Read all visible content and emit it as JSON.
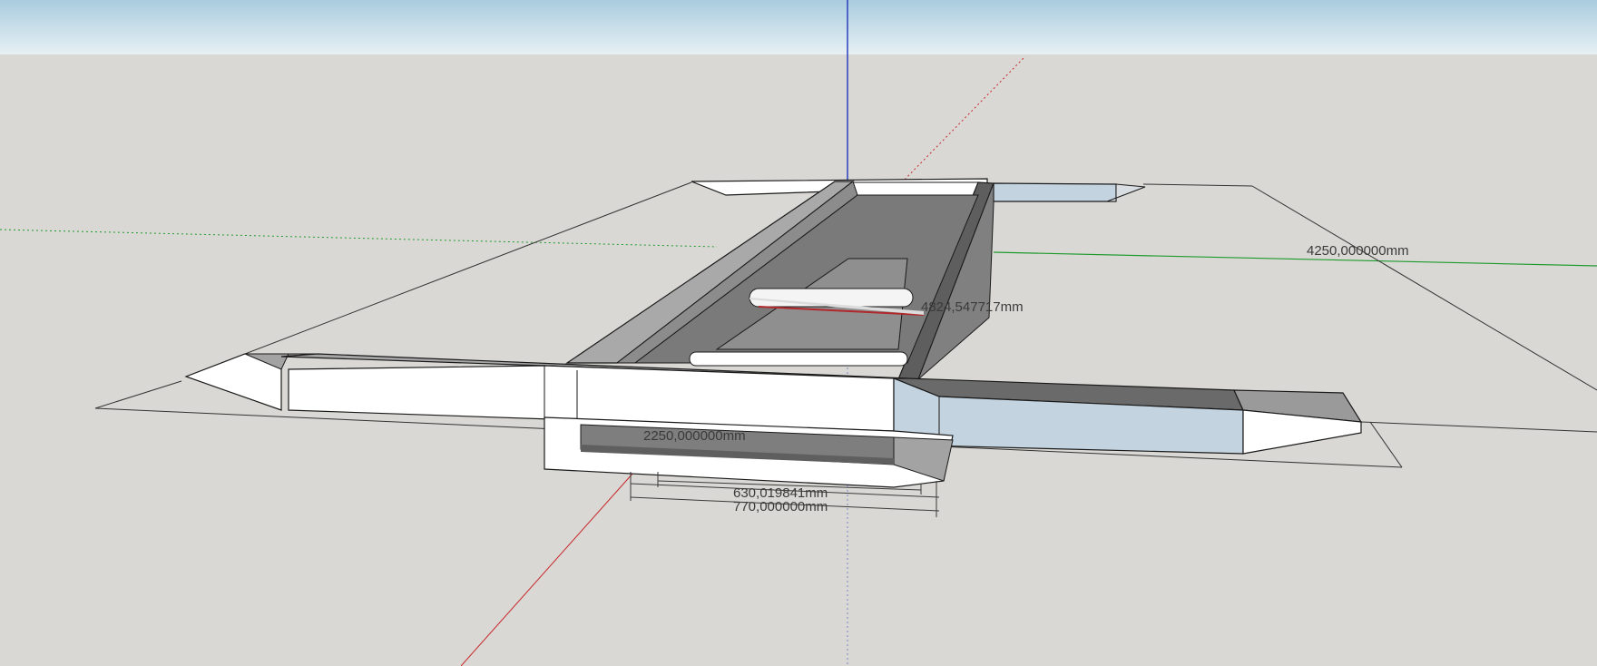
{
  "viewport": {
    "sky_top": "#a9ccde",
    "sky_bottom": "#e7f0f4",
    "ground": "#d9d8d4"
  },
  "axes": {
    "red": "#c8262a",
    "green": "#1e9a2c",
    "blue": "#2a3fbf"
  },
  "dimensions": {
    "length_total": "4250,000000mm",
    "diagonal": "4824,547717mm",
    "width_inner": "2250,000000mm",
    "width_a": "630,019841mm",
    "width_b": "770,000000mm"
  },
  "materials": {
    "face_white": "#ffffff",
    "face_light": "#f0f0f0",
    "face_mid": "#a6a6a6",
    "face_dark": "#6a6a6a",
    "face_selected": "#c3d3df"
  }
}
